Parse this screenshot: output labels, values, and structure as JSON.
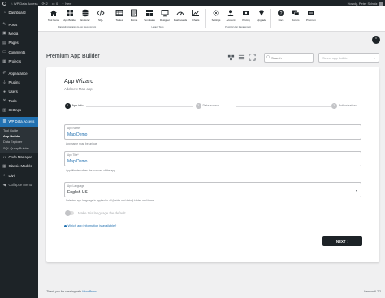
{
  "adminbar": {
    "site_name": "WP Data Access",
    "updates_count": "2",
    "comments_count": "0",
    "new_label": "New",
    "howdy": "Howdy, Peter Schulz"
  },
  "sidebar": {
    "items": [
      {
        "label": "Dashboard",
        "icon": "dashboard-icon"
      },
      {
        "label": "Posts",
        "icon": "pin-icon"
      },
      {
        "label": "Media",
        "icon": "media-icon"
      },
      {
        "label": "Pages",
        "icon": "page-icon"
      },
      {
        "label": "Comments",
        "icon": "comment-icon"
      },
      {
        "label": "Projects",
        "icon": "portfolio-icon"
      },
      {
        "label": "Appearance",
        "icon": "brush-icon"
      },
      {
        "label": "Plugins",
        "icon": "plugin-icon"
      },
      {
        "label": "Users",
        "icon": "user-icon"
      },
      {
        "label": "Tools",
        "icon": "wrench-icon"
      },
      {
        "label": "Settings",
        "icon": "settings-icon"
      },
      {
        "label": "WP Data Access",
        "icon": "database-icon"
      }
    ],
    "submenu": [
      "Tool Guide",
      "App Builder",
      "Data Explorer",
      "SQL Query Builder"
    ],
    "after_items": [
      {
        "label": "Code Manager",
        "icon": "code-icon"
      },
      {
        "label": "Classic Models",
        "icon": "table-icon"
      },
      {
        "label": "Divi",
        "icon": "divi-icon"
      },
      {
        "label": "Collapse menu",
        "icon": "collapse-icon"
      }
    ]
  },
  "toolbar": {
    "buttons": [
      {
        "label": "Tool Guide",
        "icon": "home-icon"
      },
      {
        "label": "App Builder",
        "icon": "apps-icon"
      },
      {
        "label": "Explorer",
        "icon": "database-icon"
      },
      {
        "label": "SQL",
        "icon": "code-icon"
      },
      {
        "label": "Tables",
        "icon": "table-icon"
      },
      {
        "label": "Forms",
        "icon": "forms-icon"
      },
      {
        "label": "Templates",
        "icon": "templates-icon"
      },
      {
        "label": "Designer",
        "icon": "designer-icon"
      },
      {
        "label": "Dashboards",
        "icon": "dashboard-icon"
      },
      {
        "label": "Charts",
        "icon": "chart-icon"
      },
      {
        "label": "Settings",
        "icon": "gear-icon"
      },
      {
        "label": "Account",
        "icon": "account-icon"
      },
      {
        "label": "Pricing",
        "icon": "pricing-icon"
      },
      {
        "label": "Upgrade",
        "icon": "upgrade-icon"
      },
      {
        "label": "Docs",
        "icon": "docs-icon"
      },
      {
        "label": "Forum",
        "icon": "forum-icon"
      },
      {
        "label": "Premium",
        "icon": "premium-icon"
      }
    ],
    "groups": [
      "Data Administration & App Development",
      "Legacy Tools",
      "Plugin & User Management"
    ]
  },
  "page": {
    "title": "Premium App Builder",
    "search_placeholder": "Search",
    "select_placeholder": "Select app builder"
  },
  "wizard": {
    "title": "App Wizard",
    "subtitle": "Add new Map app",
    "steps": [
      {
        "num": "1",
        "label": "App info"
      },
      {
        "num": "2",
        "label": "Data source"
      },
      {
        "num": "3",
        "label": "Authorization"
      }
    ],
    "fields": {
      "app_name": {
        "label": "App Name*",
        "value": "Map Demo",
        "helper": "App name must be unique"
      },
      "app_title": {
        "label": "App Title*",
        "value": "Map Demo",
        "helper": "App title describes the purpose of the app"
      },
      "app_language": {
        "label": "App Language",
        "value": "English US",
        "helper": "Selected app language is applied to all (inside and detail) tables and forms"
      }
    },
    "toggle_label": "Make this language the default",
    "info_link": "Which app information is available?",
    "next_label": "NEXT"
  },
  "footer": {
    "thanks_prefix": "Thank you for creating with ",
    "thanks_link": "WordPress",
    "version": "Version 6.7.2"
  },
  "colors": {
    "admin_dark": "#1d2327",
    "accent_blue": "#2271b1",
    "background": "#f0f0f1"
  }
}
